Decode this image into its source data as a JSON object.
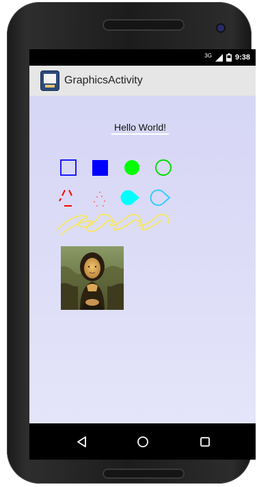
{
  "status_bar": {
    "network": "3G",
    "time": "9:38"
  },
  "app_bar": {
    "title": "GraphicsActivity",
    "icon": "app-launcher-icon"
  },
  "content": {
    "greeting": "Hello World!",
    "shapes": [
      {
        "name": "square-outline",
        "color": "#1a1aff"
      },
      {
        "name": "square-filled",
        "color": "#0000ff"
      },
      {
        "name": "circle-filled",
        "color": "#00ff00"
      },
      {
        "name": "circle-outline",
        "color": "#00dd00"
      },
      {
        "name": "dashed-triangle",
        "color": "#ff0000"
      },
      {
        "name": "dotted-triangle",
        "color": "#ff5555"
      },
      {
        "name": "pacman-filled",
        "color": "#00ffff"
      },
      {
        "name": "pacman-outline",
        "color": "#33ccff"
      },
      {
        "name": "wave-path",
        "color": "#ffee66"
      }
    ],
    "image": "mona-lisa-image"
  },
  "navigation": {
    "back": "back-icon",
    "home": "home-icon",
    "recents": "recents-icon"
  }
}
